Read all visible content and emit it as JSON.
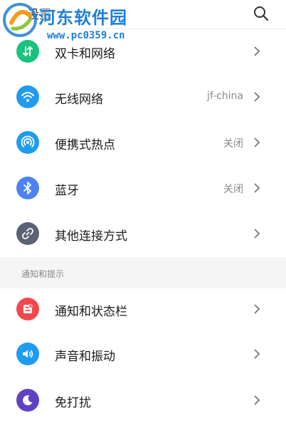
{
  "header": {
    "title": "设置"
  },
  "watermark": {
    "title": "河东软件园",
    "url": "www.pc0359.cn"
  },
  "rows_top": [
    {
      "label": "双卡和网络",
      "value": "",
      "icon": "dual-sim-icon",
      "color": "#19c37d"
    },
    {
      "label": "无线网络",
      "value": "jf-china",
      "icon": "wifi-icon",
      "color": "#1f9bf0"
    },
    {
      "label": "便携式热点",
      "value": "关闭",
      "icon": "hotspot-icon",
      "color": "#1f9bf0"
    },
    {
      "label": "蓝牙",
      "value": "关闭",
      "icon": "bluetooth-icon",
      "color": "#4d82f0"
    },
    {
      "label": "其他连接方式",
      "value": "",
      "icon": "link-icon",
      "color": "#5a6375"
    }
  ],
  "section": {
    "label": "通知和提示"
  },
  "rows_bottom": [
    {
      "label": "通知和状态栏",
      "icon": "notification-icon",
      "color": "#f0494d"
    },
    {
      "label": "声音和振动",
      "icon": "sound-icon",
      "color": "#1f9bf0"
    },
    {
      "label": "免打扰",
      "icon": "moon-icon",
      "color": "#5f42c4"
    }
  ]
}
